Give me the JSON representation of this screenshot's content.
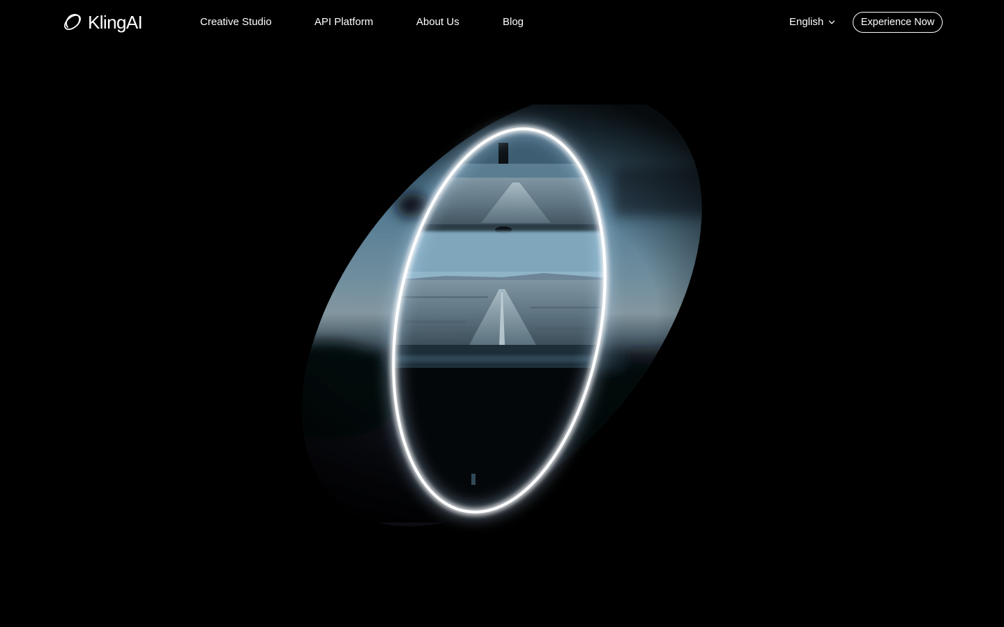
{
  "brand": {
    "name": "KlingAI",
    "logo_icon": "kling-orbit-icon"
  },
  "nav": {
    "items": [
      {
        "label": "Creative Studio"
      },
      {
        "label": "API Platform"
      },
      {
        "label": "About Us"
      },
      {
        "label": "Blog"
      }
    ]
  },
  "language": {
    "selected": "English",
    "icon": "chevron-down-icon"
  },
  "cta": {
    "label": "Experience Now"
  },
  "hero": {
    "media": "road-through-windshield-video",
    "ring_color": "#ffffff",
    "glow_color": "#9fd2ff"
  },
  "theme": {
    "background": "#000000",
    "text": "#ffffff"
  }
}
